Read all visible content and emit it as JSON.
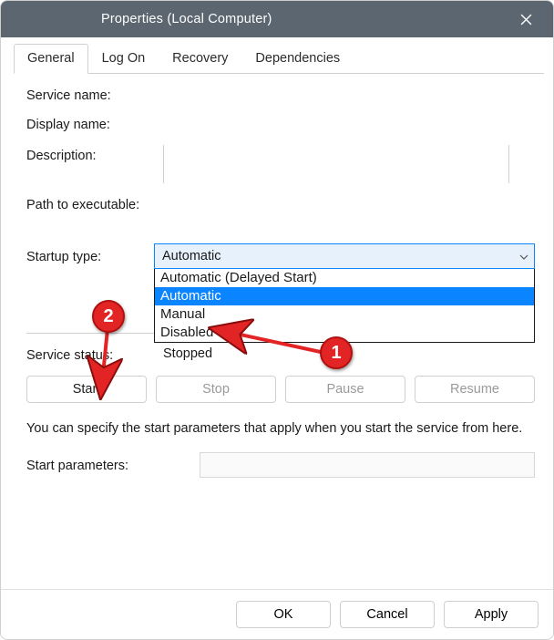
{
  "window": {
    "title": "Properties (Local Computer)"
  },
  "tabs": {
    "general": "General",
    "log_on": "Log On",
    "recovery": "Recovery",
    "dependencies": "Dependencies"
  },
  "labels": {
    "service_name": "Service name:",
    "display_name": "Display name:",
    "description": "Description:",
    "path": "Path to executable:",
    "startup_type": "Startup type:",
    "service_status": "Service status:",
    "start_parameters": "Start parameters:"
  },
  "startup": {
    "selected": "Automatic",
    "options": {
      "delayed": "Automatic (Delayed Start)",
      "automatic": "Automatic",
      "manual": "Manual",
      "disabled": "Disabled"
    }
  },
  "status_value": "Stopped",
  "buttons": {
    "start": "Start",
    "stop": "Stop",
    "pause": "Pause",
    "resume": "Resume",
    "ok": "OK",
    "cancel": "Cancel",
    "apply": "Apply"
  },
  "hint": "You can specify the start parameters that apply when you start the service from here.",
  "annotations": {
    "badge1": "1",
    "badge2": "2"
  },
  "colors": {
    "accent": "#0a84ff",
    "badge": "#e32424"
  }
}
